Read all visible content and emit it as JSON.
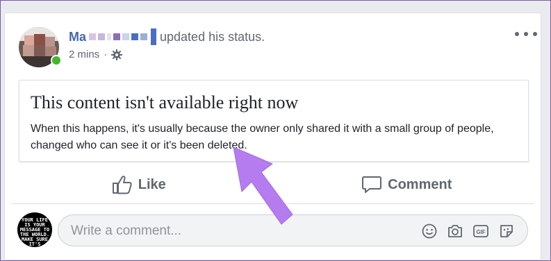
{
  "post": {
    "author_name_visible": "Ma",
    "action_text": "updated his status.",
    "time": "2 mins",
    "separator": "·",
    "privacy_icon": "gear-icon",
    "more_icon": "more-options-icon"
  },
  "notice": {
    "title": "This content isn't available right now",
    "body": "When this happens, it's usually because the owner only shared it with a small group of people, changed who can see it or it's been deleted."
  },
  "actions": {
    "like_label": "Like",
    "comment_label": "Comment"
  },
  "comment_box": {
    "placeholder": "Write a comment...",
    "avatar_text": "YOUR LIFE IS YOUR MESSAGE TO THE WORLD. MAKE SURE IT'S INSPIRING",
    "icons": [
      "emoji-icon",
      "camera-icon",
      "gif-icon",
      "sticker-icon"
    ]
  },
  "colors": {
    "link_blue": "#4267b2",
    "annotation_purple": "#b57cf0",
    "online_green": "#42b72a"
  }
}
